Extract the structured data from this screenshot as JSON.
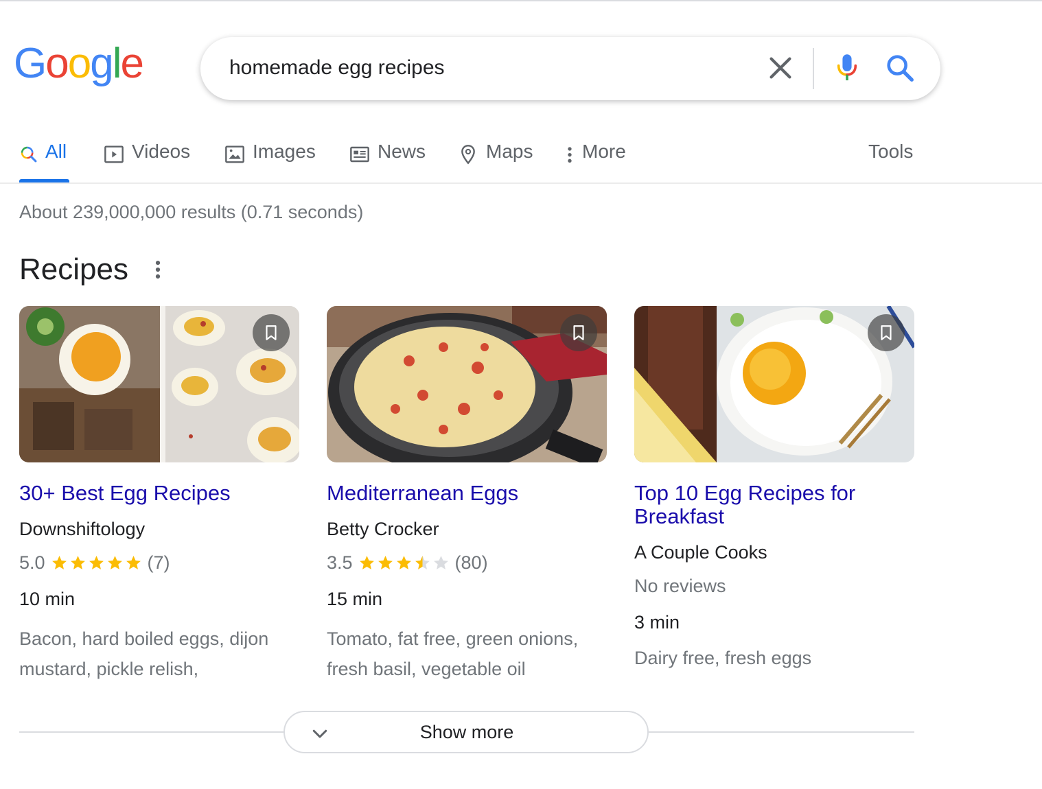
{
  "logo": {
    "letters": [
      "G",
      "o",
      "o",
      "g",
      "l",
      "e"
    ],
    "colors": [
      "#4285f4",
      "#ea4335",
      "#fbbc05",
      "#4285f4",
      "#34a853",
      "#ea4335"
    ]
  },
  "search": {
    "query": "homemade egg recipes",
    "icons": [
      "close-icon",
      "microphone-icon",
      "search-icon"
    ]
  },
  "tabs": [
    {
      "label": "All",
      "icon": "search-icon",
      "active": true
    },
    {
      "label": "Videos",
      "icon": "video-icon"
    },
    {
      "label": "Images",
      "icon": "image-icon"
    },
    {
      "label": "News",
      "icon": "news-icon"
    },
    {
      "label": "Maps",
      "icon": "map-pin-icon"
    },
    {
      "label": "More",
      "icon": "vertical-dots-icon"
    }
  ],
  "tools_label": "Tools",
  "results_count": "About 239,000,000 results (0.71 seconds)",
  "section": {
    "title": "Recipes"
  },
  "cards": [
    {
      "title": "30+ Best Egg Recipes",
      "source": "Downshiftology",
      "rating_value": "5.0",
      "stars": 5.0,
      "reviews": "(7)",
      "time": "10 min",
      "ingredients_line1": "Bacon, hard boiled eggs, dijon",
      "ingredients_line2": "mustard, pickle relish,"
    },
    {
      "title": "Mediterranean Eggs",
      "source": "Betty Crocker",
      "rating_value": "3.5",
      "stars": 3.5,
      "reviews": "(80)",
      "time": "15 min",
      "ingredients_line1": "Tomato, fat free, green onions,",
      "ingredients_line2": "fresh basil, vegetable oil"
    },
    {
      "title_line1": "Top 10 Egg Recipes for",
      "title_line2": "Breakfast",
      "source": "A Couple Cooks",
      "no_reviews": "No reviews",
      "time": "3 min",
      "ingredients_line1": "Dairy free, fresh eggs"
    }
  ],
  "show_more": {
    "label": "Show more"
  },
  "colors": {
    "link": "#1a0dab",
    "accent": "#1a73e8",
    "star": "#fbbc04",
    "muted": "#70757a"
  }
}
